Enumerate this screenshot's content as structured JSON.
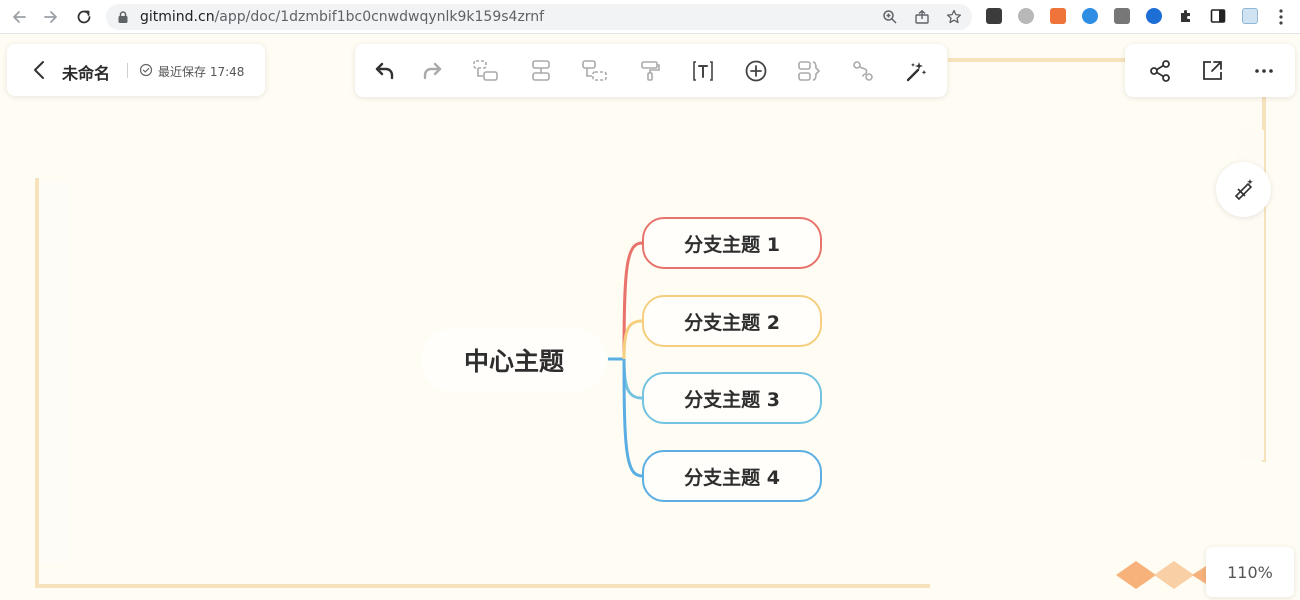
{
  "browser": {
    "url_host": "gitmind.cn",
    "url_path": "/app/doc/1dzmbif1bc0cnwdwqynlk9k159s4zrnf"
  },
  "document": {
    "title": "未命名",
    "save_status": "最近保存 17:48"
  },
  "toolbar": {
    "tools": [
      "undo-icon",
      "redo-icon",
      "insert-child-topic-icon",
      "insert-sibling-topic-icon",
      "insert-parent-topic-icon",
      "format-painter-icon",
      "text-box-icon",
      "add-topic-icon",
      "summary-icon",
      "relationship-line-icon",
      "style-wand-icon"
    ]
  },
  "right_toolbar": {
    "tools": [
      "share-icon",
      "export-icon",
      "more-icon"
    ]
  },
  "mindmap": {
    "central_topic": "中心主题",
    "branches": [
      {
        "label": "分支主题 1",
        "color": "#e8736c"
      },
      {
        "label": "分支主题 2",
        "color": "#f5cf7e"
      },
      {
        "label": "分支主题 3",
        "color": "#74c3e0"
      },
      {
        "label": "分支主题 4",
        "color": "#5aaee4"
      }
    ],
    "central_connector_color": "#5aaee4"
  },
  "zoom": {
    "level": "110%"
  },
  "colors": {
    "canvas_bg": "#fffdf3",
    "frame_accent": "#f7e3bb",
    "diamond_accent": "#f6b27a"
  }
}
